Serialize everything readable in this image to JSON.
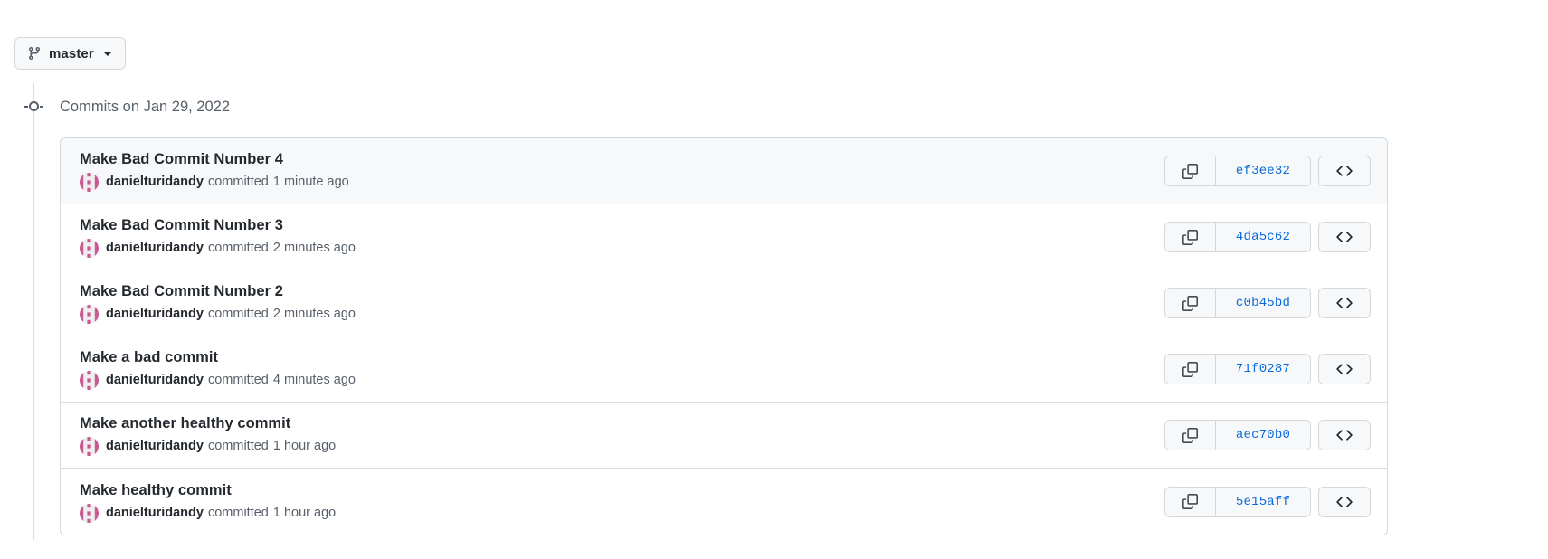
{
  "branch_selector": {
    "label": "master",
    "icon": "git-branch-icon",
    "caret_icon": "chevron-down-icon"
  },
  "timeline": {
    "date_header": "Commits on Jan 29, 2022"
  },
  "commits": [
    {
      "title": "Make Bad Commit Number 4",
      "author": "danielturidandy",
      "action": "committed",
      "time": "1 minute ago",
      "sha": "ef3ee32",
      "highlighted": true
    },
    {
      "title": "Make Bad Commit Number 3",
      "author": "danielturidandy",
      "action": "committed",
      "time": "2 minutes ago",
      "sha": "4da5c62",
      "highlighted": false
    },
    {
      "title": "Make Bad Commit Number 2",
      "author": "danielturidandy",
      "action": "committed",
      "time": "2 minutes ago",
      "sha": "c0b45bd",
      "highlighted": false
    },
    {
      "title": "Make a bad commit",
      "author": "danielturidandy",
      "action": "committed",
      "time": "4 minutes ago",
      "sha": "71f0287",
      "highlighted": false
    },
    {
      "title": "Make another healthy commit",
      "author": "danielturidandy",
      "action": "committed",
      "time": "1 hour ago",
      "sha": "aec70b0",
      "highlighted": false
    },
    {
      "title": "Make healthy commit",
      "author": "danielturidandy",
      "action": "committed",
      "time": "1 hour ago",
      "sha": "5e15aff",
      "highlighted": false
    }
  ],
  "row_actions": {
    "copy_icon": "copy-icon",
    "browse_icon": "code-brackets-icon"
  },
  "colors": {
    "link": "#0969da",
    "text": "#24292f",
    "muted": "#57606a",
    "border": "#d0d7de",
    "row_highlight": "#f6f8fa",
    "avatar_accent": "#c9578f"
  }
}
